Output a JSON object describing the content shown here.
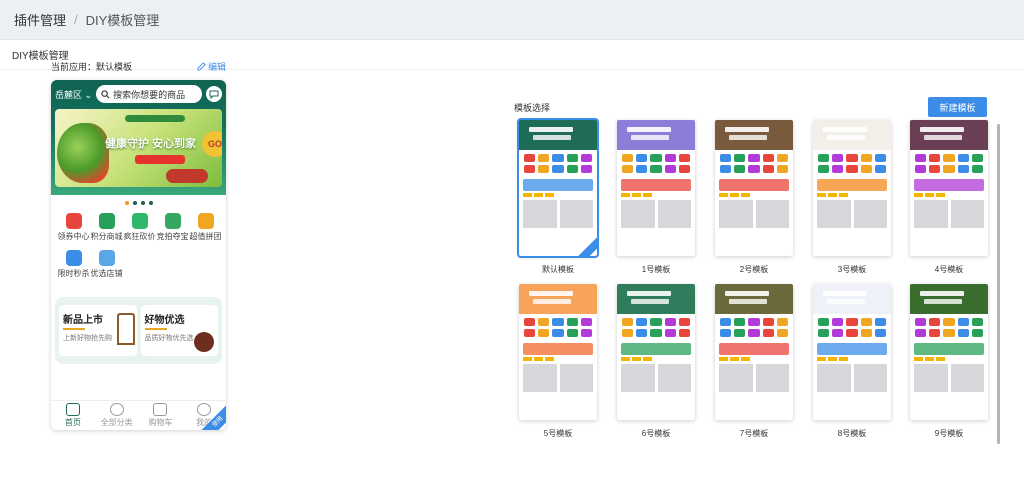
{
  "breadcrumb": {
    "root": "插件管理",
    "separator": "/",
    "current": "DIY模板管理"
  },
  "page": {
    "subtitle": "DIY模板管理"
  },
  "current_app": {
    "label": "当前应用：默认模板",
    "edit": "编辑"
  },
  "phone": {
    "region": "岳麓区",
    "search_placeholder": "搜索你想要的商品",
    "slogan": "健康守护 安心到家",
    "badge": "GO",
    "icons": [
      {
        "label": "领券中心",
        "color": "#e8463c",
        "icon": "ticket-icon"
      },
      {
        "label": "积分商城",
        "color": "#27a05a",
        "icon": "bag-icon"
      },
      {
        "label": "疯狂砍价",
        "color": "#2fb86b",
        "icon": "tag-icon"
      },
      {
        "label": "竞拍夺宝",
        "color": "#36a763",
        "icon": "hammer-icon"
      },
      {
        "label": "超值拼团",
        "color": "#f0a623",
        "icon": "group-icon"
      },
      {
        "label": "限时秒杀",
        "color": "#3b8de8",
        "icon": "flash-icon"
      },
      {
        "label": "优选店铺",
        "color": "#5aa7e8",
        "icon": "store-icon"
      }
    ],
    "promos": [
      {
        "title": "新品上市",
        "sub": "上新好物抢先购"
      },
      {
        "title": "好物优选",
        "sub": "品质好物优先选"
      }
    ],
    "tabs": [
      {
        "label": "首页",
        "icon": "home-icon"
      },
      {
        "label": "全部分类",
        "icon": "category-icon"
      },
      {
        "label": "购物车",
        "icon": "cart-icon"
      },
      {
        "label": "我的",
        "icon": "user-icon"
      }
    ],
    "corner": "使用"
  },
  "templates": {
    "title": "模板选择",
    "new_button": "新建模板",
    "items": [
      {
        "name": "默认模板",
        "head": "#1e6b57",
        "accent": "#3b8de8",
        "selected": true
      },
      {
        "name": "1号模板",
        "head": "#8d7dd9",
        "accent": "#e8463c",
        "selected": false
      },
      {
        "name": "2号模板",
        "head": "#7a5a3c",
        "accent": "#e8463c",
        "selected": false
      },
      {
        "name": "3号模板",
        "head": "#f2efe9",
        "accent": "#f28a1c",
        "selected": false
      },
      {
        "name": "4号模板",
        "head": "#6a3f55",
        "accent": "#b13ad8",
        "selected": false
      },
      {
        "name": "5号模板",
        "head": "#f7a35a",
        "accent": "#f26a2c",
        "selected": false
      },
      {
        "name": "6号模板",
        "head": "#2f7d5c",
        "accent": "#27a05a",
        "selected": false
      },
      {
        "name": "7号模板",
        "head": "#6b6a3c",
        "accent": "#e8463c",
        "selected": false
      },
      {
        "name": "8号模板",
        "head": "#eef2f8",
        "accent": "#3b8de8",
        "selected": false
      },
      {
        "name": "9号模板",
        "head": "#3a6e2f",
        "accent": "#27a05a",
        "selected": false
      }
    ]
  }
}
